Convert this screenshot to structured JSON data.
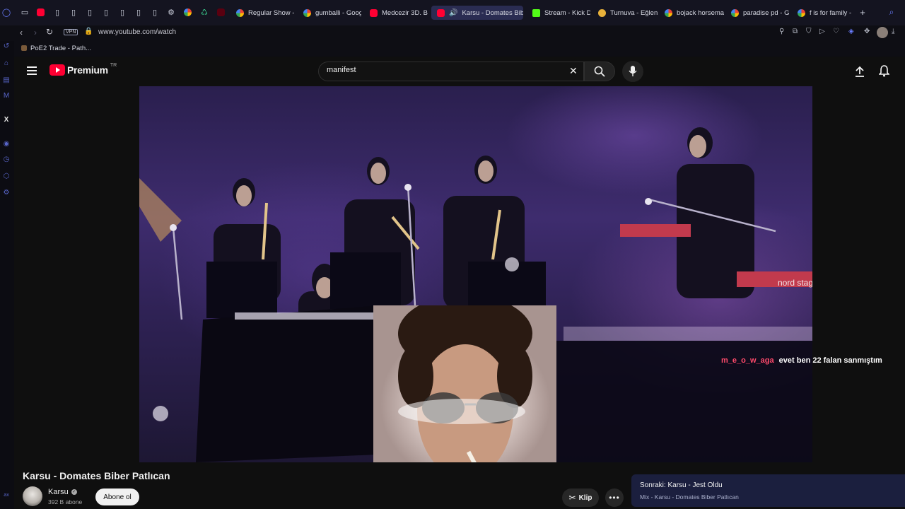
{
  "browser": {
    "tabs": [
      {
        "label": "Regular Show -",
        "favicon": "chrome"
      },
      {
        "label": "gumballi - Goog",
        "favicon": "chrome"
      },
      {
        "label": "Medcezir 3D. B",
        "favicon": "youtube"
      },
      {
        "label": "Karsu - Domates Bibe",
        "favicon": "youtube",
        "active": true
      },
      {
        "label": "Stream - Kick D",
        "favicon": "kick"
      },
      {
        "label": "Turnuva - Eğlen",
        "favicon": "tv"
      },
      {
        "label": "bojack horsema",
        "favicon": "chrome"
      },
      {
        "label": "paradise pd - G",
        "favicon": "chrome"
      },
      {
        "label": "f is for family -",
        "favicon": "chrome"
      }
    ],
    "vpn_badge": "VPN",
    "url": "www.youtube.com/watch",
    "bookmark": "PoE2 Trade - Path...",
    "accent_color": "#5865c8"
  },
  "youtube": {
    "logo_text": "Premium",
    "region": "TR",
    "search_value": "manifest",
    "video_title": "Karsu - Domates Biber Patlıcan",
    "channel_name": "Karsu",
    "subscribers": "392 B abone",
    "subscribe_label": "Abone ol",
    "clip_label": "Klip",
    "up_next_title": "Sonraki: Karsu - Jest Oldu",
    "up_next_sub": "Mix - Karsu - Domates Biber Patlıcan",
    "video_overlay_text": "nord stage"
  },
  "chat": {
    "user": "m_e_o_w_aga",
    "message": "evet ben 22 falan sanmıştım",
    "user_color": "#ff4a6b"
  }
}
